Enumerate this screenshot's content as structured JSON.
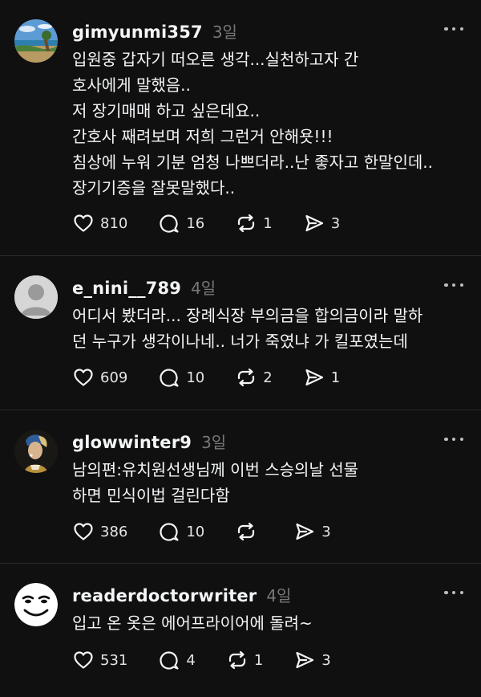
{
  "posts": [
    {
      "username": "gimyunmi357",
      "time": "3일",
      "lines": [
        "입원중 갑자기 떠오른 생각...실천하고자 간",
        "호사에게 말했음..",
        "저 장기매매 하고 싶은데요..",
        "간호사 째려보며 저희 그런거 안해욧!!!",
        "침상에 누워 기분 엄청 나쁘더라..난 좋자고 한말인데..",
        "장기기증을 잘못말했다.."
      ],
      "likes": "810",
      "replies": "16",
      "reposts": "1",
      "shares": "3"
    },
    {
      "username": "e_nini__789",
      "time": "4일",
      "lines": [
        "어디서 봤더라... 장례식장 부의금을 합의금이라 말하",
        "던 누구가 생각이나네.. 너가 죽였냐 가 킬포였는데"
      ],
      "likes": "609",
      "replies": "10",
      "reposts": "2",
      "shares": "1"
    },
    {
      "username": "glowwinter9",
      "time": "3일",
      "lines": [
        "남의편:유치원선생님께 이번 스승의날 선물",
        "하면 민식이법 걸린다함"
      ],
      "likes": "386",
      "replies": "10",
      "reposts": "",
      "shares": "3"
    },
    {
      "username": "readerdoctorwriter",
      "time": "4일",
      "lines": [
        "입고 온 옷은 에어프라이어에 돌려~"
      ],
      "likes": "531",
      "replies": "4",
      "reposts": "1",
      "shares": "3"
    }
  ],
  "icons": {
    "like": "heart-icon",
    "reply": "comment-icon",
    "repost": "repost-icon",
    "share": "share-icon",
    "more": "more-icon"
  },
  "colors": {
    "background": "#101010",
    "text": "#f3f5f7",
    "muted": "#777777",
    "divider": "#2b2b2b"
  }
}
